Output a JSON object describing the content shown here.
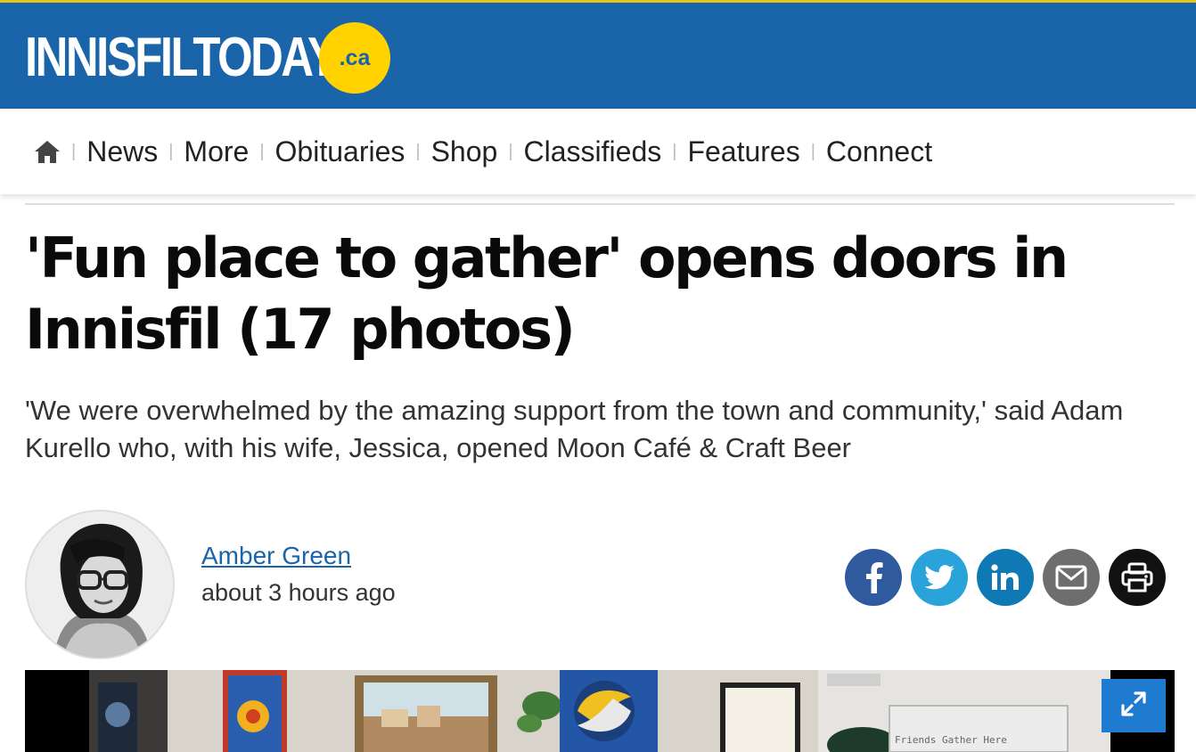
{
  "site": {
    "logo_text": "INNISFILTODAY",
    "logo_suffix": ".ca",
    "brand_color": "#1a65a9",
    "accent_color": "#ffd200"
  },
  "nav": {
    "home_icon": "home-icon",
    "items": [
      {
        "label": "News"
      },
      {
        "label": "More"
      },
      {
        "label": "Obituaries"
      },
      {
        "label": "Shop"
      },
      {
        "label": "Classifieds"
      },
      {
        "label": "Features"
      },
      {
        "label": "Connect"
      }
    ]
  },
  "article": {
    "headline": "'Fun place to gather' opens doors in Innisfil (17 photos)",
    "dek": "'We were overwhelmed by the amazing support from the town and community,' said Adam Kurello who, with his wife, Jessica, opened Moon Café & Craft Beer",
    "author": "Amber Green",
    "timestamp": "about 3 hours ago",
    "photo_sign_text": "Friends Gather Here"
  },
  "share": [
    {
      "name": "facebook",
      "icon": "facebook-icon",
      "color": "#2f5a9e"
    },
    {
      "name": "twitter",
      "icon": "twitter-icon",
      "color": "#2aa3da"
    },
    {
      "name": "linkedin",
      "icon": "linkedin-icon",
      "color": "#0f78b5"
    },
    {
      "name": "email",
      "icon": "email-icon",
      "color": "#6e6e6e"
    },
    {
      "name": "print",
      "icon": "print-icon",
      "color": "#111111"
    }
  ],
  "gallery": {
    "expand_icon": "expand-icon",
    "button_color": "#1f7bd0"
  }
}
